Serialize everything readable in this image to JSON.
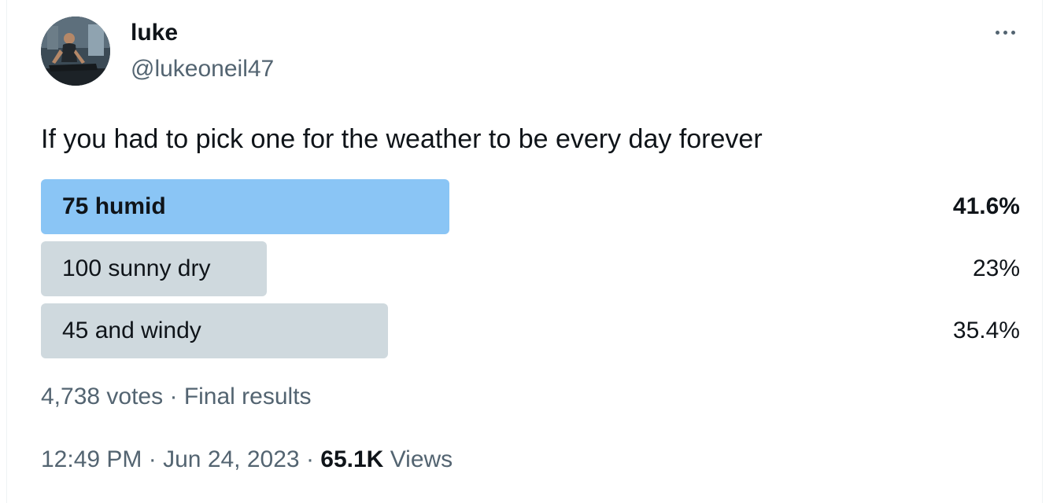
{
  "author": {
    "name": "luke",
    "handle": "@lukeoneil47",
    "avatar_icon": "user-avatar-photo"
  },
  "more_icon": "more-options-icon",
  "tweet": {
    "text": "If you had to pick one for the weather to be every day forever"
  },
  "poll": {
    "options": [
      {
        "label": "75 humid",
        "percent": "41.6%",
        "value": 41.6,
        "winner": true
      },
      {
        "label": "100 sunny dry",
        "percent": "23%",
        "value": 23,
        "winner": false
      },
      {
        "label": "45 and windy",
        "percent": "35.4%",
        "value": 35.4,
        "winner": false
      }
    ],
    "votes": "4,738 votes",
    "separator": "·",
    "status": "Final results"
  },
  "meta": {
    "time": "12:49 PM",
    "separator": "·",
    "date": "Jun 24, 2023",
    "views_count": "65.1K",
    "views_label": "Views"
  },
  "colors": {
    "winner_bar": "#8ac5f5",
    "other_bar": "#cfd9de",
    "secondary_text": "#536471",
    "primary_text": "#0f1419"
  }
}
